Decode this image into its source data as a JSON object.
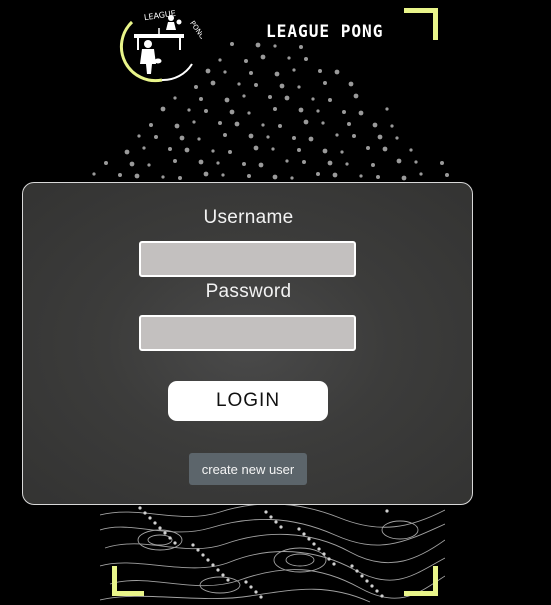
{
  "brand": {
    "title": "LEAGUE PONG",
    "logo_text": "LEAGUE PONG",
    "accent_color": "#e9f58a"
  },
  "login_form": {
    "username_label": "Username",
    "username_value": "",
    "password_label": "Password",
    "password_value": "",
    "login_label": "LOGIN",
    "create_user_label": "create new user"
  },
  "icons": {
    "logo": "ping-pong-player-logo"
  }
}
